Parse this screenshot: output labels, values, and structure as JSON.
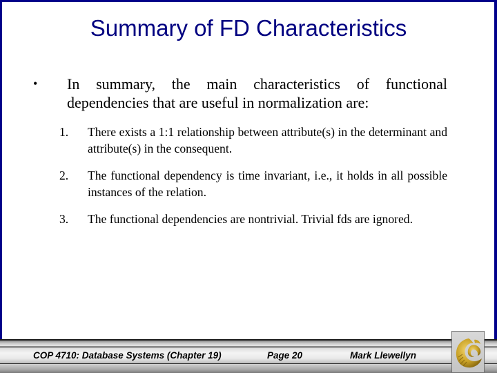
{
  "slide": {
    "title": "Summary of FD Characteristics",
    "bullet_symbol": "•",
    "intro": "In summary, the main characteristics of functional dependencies that are useful in normalization are:",
    "items": [
      {
        "number": "1.",
        "text": "There exists a 1:1 relationship between attribute(s) in the determinant and attribute(s) in the consequent."
      },
      {
        "number": "2.",
        "text": "The functional dependency is time invariant, i.e., it holds in all possible instances of the relation."
      },
      {
        "number": "3.",
        "text": "The functional dependencies are nontrivial.  Trivial fds are ignored."
      }
    ]
  },
  "footer": {
    "course": "COP 4710: Database Systems  (Chapter 19)",
    "page": "Page 20",
    "author": "Mark Llewellyn",
    "logo": "ucf-pegasus-logo-icon"
  },
  "colors": {
    "frame_border": "#00008b",
    "title": "#000080",
    "logo_gold": "#c9a227"
  }
}
